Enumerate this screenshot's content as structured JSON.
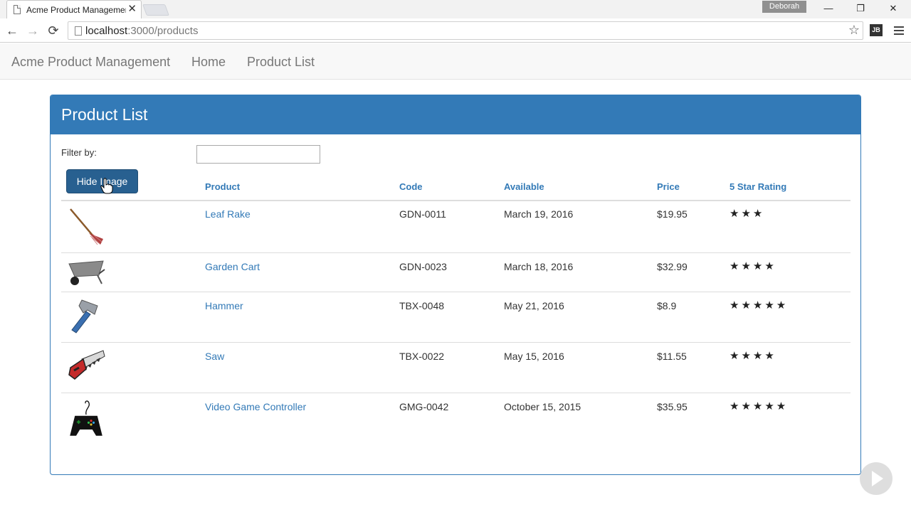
{
  "browser": {
    "tab_title": "Acme Product Management",
    "tab_close": "✕",
    "profile_name": "Deborah",
    "url_host": "localhost",
    "url_path": ":3000/products",
    "back": "←",
    "forward": "→",
    "reload": "⟳",
    "minimize": "—",
    "restore": "❐",
    "close": "✕",
    "jb_label": "JB",
    "star": "☆"
  },
  "appnav": {
    "brand": "Acme Product Management",
    "links": [
      "Home",
      "Product List"
    ]
  },
  "panel": {
    "title": "Product List",
    "filter_label": "Filter by:",
    "filter_value": "",
    "hide_image_button": "Hide Image"
  },
  "table": {
    "headers": [
      "Product",
      "Code",
      "Available",
      "Price",
      "5 Star Rating"
    ],
    "rows": [
      {
        "image": "leaf-rake",
        "name": "Leaf Rake",
        "code": "GDN-0011",
        "available": "March 19, 2016",
        "price": "$19.95",
        "rating": 3.2,
        "stars": "★★★"
      },
      {
        "image": "garden-cart",
        "name": "Garden Cart",
        "code": "GDN-0023",
        "available": "March 18, 2016",
        "price": "$32.99",
        "rating": 4.2,
        "stars": "★★★★"
      },
      {
        "image": "hammer",
        "name": "Hammer",
        "code": "TBX-0048",
        "available": "May 21, 2016",
        "price": "$8.9",
        "rating": 4.8,
        "stars": "★★★★★"
      },
      {
        "image": "saw",
        "name": "Saw",
        "code": "TBX-0022",
        "available": "May 15, 2016",
        "price": "$11.55",
        "rating": 3.7,
        "stars": "★★★★"
      },
      {
        "image": "video-game-controller",
        "name": "Video Game Controller",
        "code": "GMG-0042",
        "available": "October 15, 2015",
        "price": "$35.95",
        "rating": 4.6,
        "stars": "★★★★★"
      }
    ]
  },
  "colors": {
    "primary": "#337ab7",
    "button": "#286090",
    "navbar": "#f8f8f8"
  }
}
